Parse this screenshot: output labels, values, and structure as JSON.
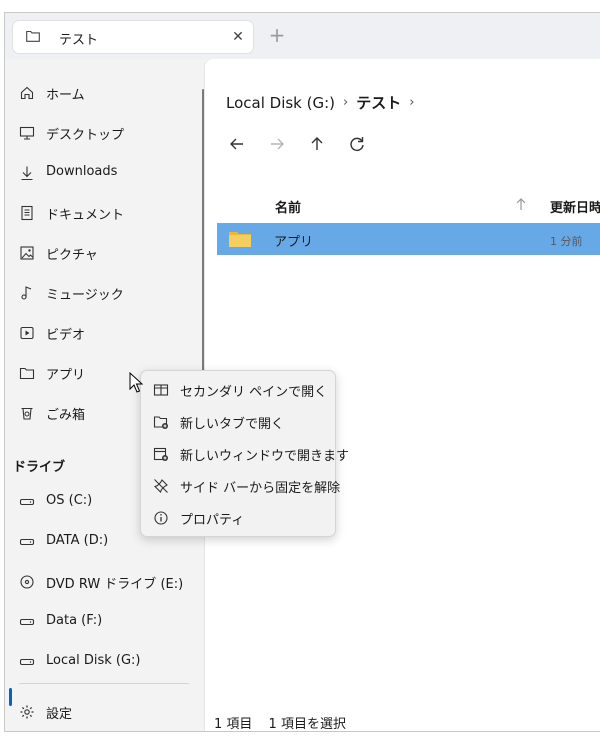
{
  "tab": {
    "title": "テスト",
    "new_tab": "+"
  },
  "sidebar": {
    "items": [
      {
        "label": "ホーム",
        "icon": "home-icon"
      },
      {
        "label": "デスクトップ",
        "icon": "desktop-icon"
      },
      {
        "label": "Downloads",
        "icon": "download-icon"
      },
      {
        "label": "ドキュメント",
        "icon": "document-icon"
      },
      {
        "label": "ピクチャ",
        "icon": "picture-icon"
      },
      {
        "label": "ミュージック",
        "icon": "music-icon"
      },
      {
        "label": "ビデオ",
        "icon": "video-icon"
      },
      {
        "label": "アプリ",
        "icon": "folder-icon"
      },
      {
        "label": "ごみ箱",
        "icon": "recycle-bin-icon"
      }
    ],
    "drives_title": "ドライブ",
    "drives": [
      {
        "label": "OS (C:)",
        "icon": "drive-icon"
      },
      {
        "label": "DATA (D:)",
        "icon": "drive-icon"
      },
      {
        "label": "DVD RW ドライブ (E:)",
        "icon": "dvd-drive-icon"
      },
      {
        "label": "Data (F:)",
        "icon": "drive-icon"
      },
      {
        "label": "Local Disk (G:)",
        "icon": "drive-icon"
      }
    ],
    "settings": {
      "label": "設定",
      "icon": "gear-icon"
    }
  },
  "breadcrumb": {
    "root": "Local Disk (G:)",
    "current": "テスト",
    "separator": "›"
  },
  "columns": {
    "name": "名前",
    "modified": "更新日時"
  },
  "files": [
    {
      "name": "アプリ",
      "modified": "1 分前"
    }
  ],
  "status": {
    "count": "1 項目",
    "selected": "1 項目を選択"
  },
  "context_menu": [
    {
      "label": "セカンダリ ペインで開く",
      "icon": "split-pane-icon"
    },
    {
      "label": "新しいタブで開く",
      "icon": "new-tab-icon"
    },
    {
      "label": "新しいウィンドウで開きます",
      "icon": "new-window-icon"
    },
    {
      "label": "サイド バーから固定を解除",
      "icon": "unpin-icon"
    },
    {
      "label": "プロパティ",
      "icon": "info-icon"
    }
  ],
  "colors": {
    "selection": "#67a9e6",
    "accent": "#0067c0",
    "folder": "#f4cf5e"
  }
}
